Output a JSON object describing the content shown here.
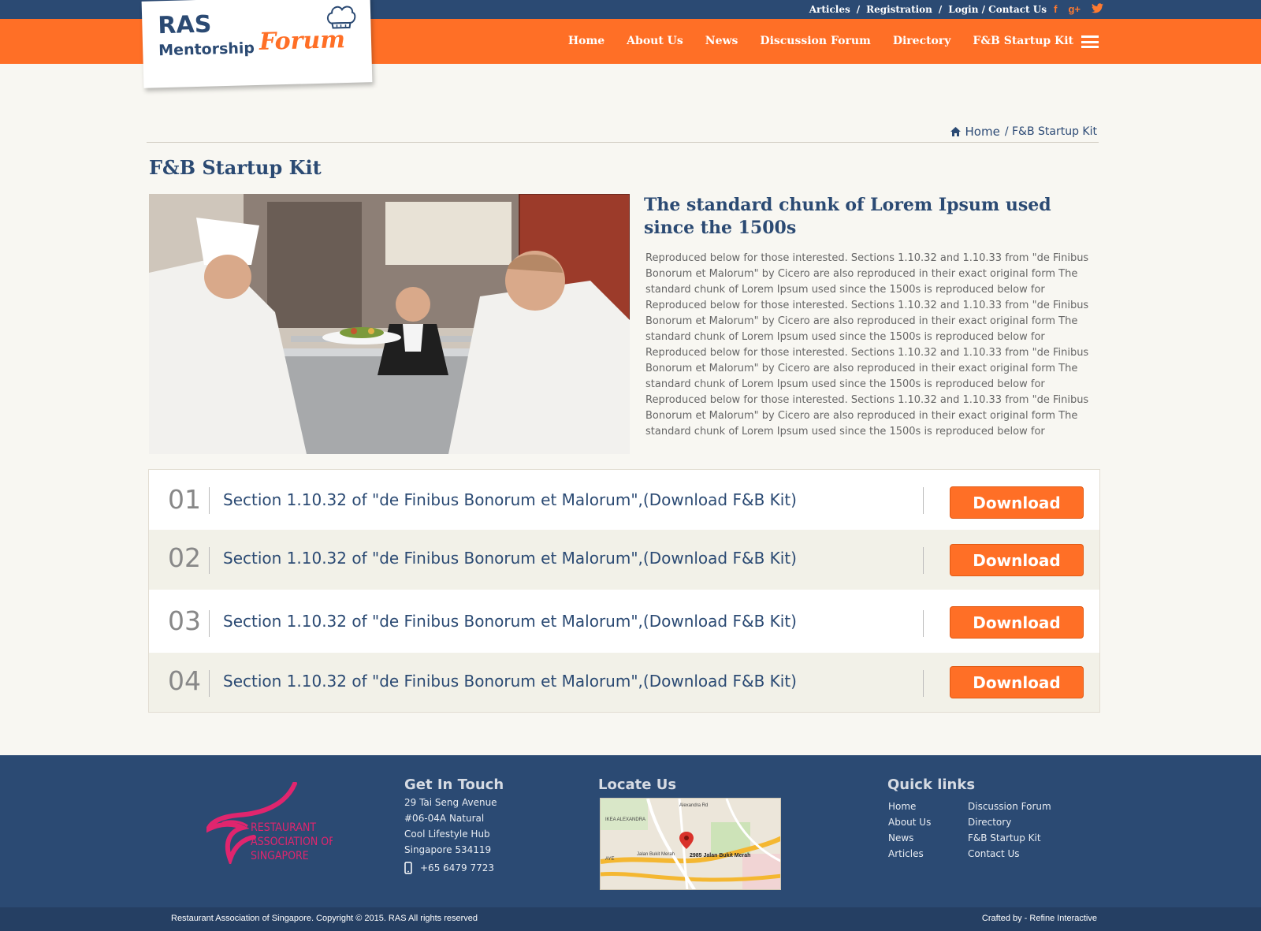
{
  "top_links": [
    "Articles",
    "Registration",
    "Login / Contact Us"
  ],
  "top_separator": "/",
  "social": {
    "facebook": "f",
    "googleplus": "g+",
    "twitter": "t"
  },
  "logo": {
    "line1": "RAS",
    "line2": "Mentorship",
    "line3": "Forum"
  },
  "nav": [
    "Home",
    "About Us",
    "News",
    "Discussion Forum",
    "Directory",
    "F&B Startup Kit"
  ],
  "breadcrumb": {
    "home": "Home",
    "current": "/ F&B Startup Kit"
  },
  "page_title": "F&B Startup Kit",
  "intro": {
    "title": "The standard chunk of Lorem Ipsum used since the 1500s",
    "text": "Reproduced below for those interested. Sections 1.10.32 and 1.10.33 from \"de Finibus Bonorum et Malorum\" by Cicero are also reproduced in their exact original form The standard chunk of Lorem Ipsum used since the 1500s is reproduced below for Reproduced below for those interested. Sections 1.10.32 and 1.10.33 from \"de Finibus Bonorum et Malorum\" by Cicero are also reproduced in their exact original form The standard chunk of Lorem Ipsum used since the 1500s is reproduced below for Reproduced below for those interested. Sections 1.10.32 and 1.10.33 from \"de Finibus Bonorum et Malorum\" by Cicero are also reproduced in their exact original form The standard chunk of Lorem Ipsum used since the 1500s is reproduced below for Reproduced below for those interested. Sections 1.10.32 and 1.10.33 from \"de Finibus Bonorum et Malorum\" by Cicero are also reproduced in their exact original form The standard chunk of Lorem Ipsum used since the 1500s is reproduced below for"
  },
  "downloads": [
    {
      "num": "01",
      "text": "Section 1.10.32 of \"de Finibus Bonorum et Malorum\",(Download F&B Kit)",
      "button": "Download"
    },
    {
      "num": "02",
      "text": "Section 1.10.32 of \"de Finibus Bonorum et Malorum\",(Download F&B Kit)",
      "button": "Download"
    },
    {
      "num": "03",
      "text": "Section 1.10.32 of \"de Finibus Bonorum et Malorum\",(Download F&B Kit)",
      "button": "Download"
    },
    {
      "num": "04",
      "text": "Section 1.10.32 of \"de Finibus Bonorum et Malorum\",(Download F&B Kit)",
      "button": "Download"
    }
  ],
  "footer": {
    "ras_logo": {
      "line1": "RESTAURANT",
      "line2": "ASSOCIATION OF",
      "line3": "SINGAPORE"
    },
    "contact": {
      "heading": "Get In Touch",
      "address": [
        "29 Tai Seng Avenue",
        "#06-04A Natural",
        "Cool Lifestyle Hub",
        "Singapore 534119"
      ],
      "phone": "+65 6479 7723"
    },
    "locate": {
      "heading": "Locate Us",
      "map_label": "2985 Jalan Bukit Merah",
      "map_streets": [
        "Alexandra Rd",
        "IKEA ALEXANDRA",
        "Jalan Bukit Merah",
        "AYE"
      ]
    },
    "quicklinks": {
      "heading": "Quick links",
      "col1": [
        "Home",
        "About Us",
        "News",
        "Articles"
      ],
      "col2": [
        "Discussion Forum",
        "Directory",
        "F&B Startup Kit",
        "Contact Us"
      ]
    },
    "copyright": "Restaurant Association of Singapore. Copyright © 2015. RAS All rights reserved",
    "crafted": "Crafted by - Refine Interactive"
  },
  "colors": {
    "navy": "#2b4a73",
    "orange": "#ff6f26",
    "background": "#f8f7f2"
  }
}
